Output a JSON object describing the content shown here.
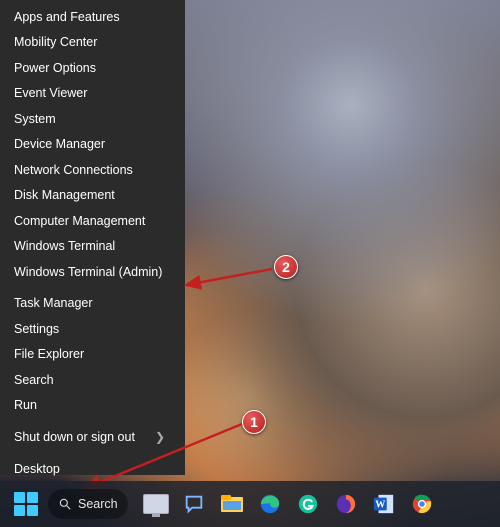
{
  "menu": {
    "items": [
      "Apps and Features",
      "Mobility Center",
      "Power Options",
      "Event Viewer",
      "System",
      "Device Manager",
      "Network Connections",
      "Disk Management",
      "Computer Management",
      "Windows Terminal",
      "Windows Terminal (Admin)"
    ],
    "items2": [
      "Task Manager",
      "Settings",
      "File Explorer",
      "Search",
      "Run"
    ],
    "submenu": "Shut down or sign out",
    "items3": [
      "Desktop"
    ]
  },
  "search": {
    "label": "Search"
  },
  "annotations": {
    "one": "1",
    "two": "2"
  },
  "taskbar": {
    "icons": [
      "start-icon",
      "search-pill",
      "taskview-icon",
      "chat-icon",
      "explorer-icon",
      "edge-icon",
      "grammarly-icon",
      "firefox-icon",
      "word-icon",
      "chrome-icon"
    ]
  }
}
